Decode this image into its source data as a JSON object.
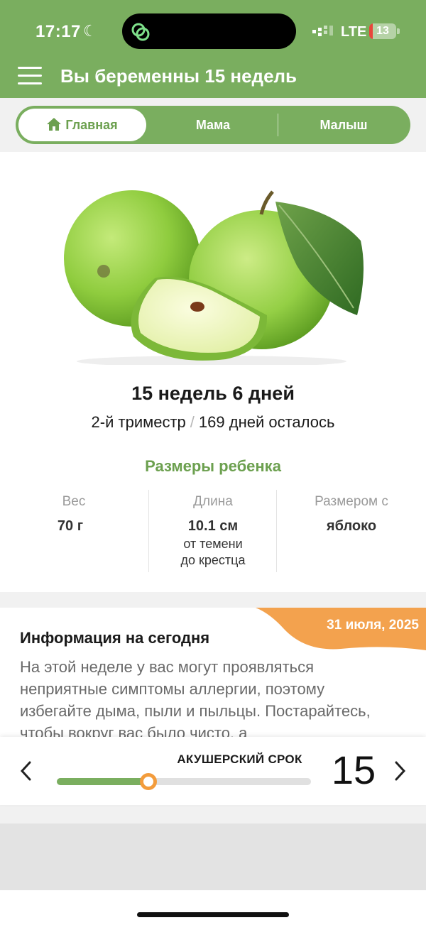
{
  "status": {
    "time": "17:17",
    "network": "LTE",
    "battery": "13",
    "battery_level": 0.13
  },
  "header": {
    "title": "Вы беременны 15 недель"
  },
  "tabs": [
    {
      "label": "Главная",
      "active": true
    },
    {
      "label": "Мама",
      "active": false
    },
    {
      "label": "Малыш",
      "active": false
    }
  ],
  "summary": {
    "weeks_days": "15 недель 6 дней",
    "trimester": "2-й триместр",
    "separator": "/",
    "days_left": "169 дней осталось"
  },
  "baby_size": {
    "title": "Размеры ребенка",
    "weight": {
      "label": "Вес",
      "value": "70 г"
    },
    "length": {
      "label": "Длина",
      "value": "10.1 см",
      "note": "от темени до крестца"
    },
    "compare": {
      "label": "Размером с",
      "value": "яблоко"
    }
  },
  "info": {
    "date": "31 июля, 2025",
    "title": "Информация на сегодня",
    "body": "На этой неделе у вас могут проявляться неприятные симптомы аллергии, поэтому избегайте дыма, пыли и пыльцы. Постарайтесь, чтобы вокруг вас было чисто, а"
  },
  "term": {
    "label": "АКУШЕРСКИЙ СРОК",
    "week": "15",
    "progress": 0.36
  },
  "colors": {
    "brand_green": "#7aae5f",
    "accent_orange": "#f39c3c"
  },
  "icons": [
    "moon-icon",
    "app-icon",
    "signal-icon",
    "menu-icon",
    "home-icon",
    "chevron-left-icon",
    "chevron-right-icon"
  ]
}
